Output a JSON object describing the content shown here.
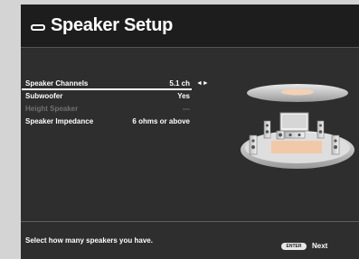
{
  "header": {
    "title": "Speaker Setup",
    "title_icon": "speaker-setup-icon"
  },
  "menu": {
    "items": [
      {
        "label": "Speaker Channels",
        "value": "5.1 ch",
        "selected": true,
        "enabled": true
      },
      {
        "label": "Subwoofer",
        "value": "Yes",
        "selected": false,
        "enabled": true
      },
      {
        "label": "Height Speaker",
        "value": "---",
        "selected": false,
        "enabled": false
      },
      {
        "label": "Speaker Impedance",
        "value": "6 ohms or above",
        "selected": false,
        "enabled": true
      }
    ],
    "adjust_arrows": "◄►"
  },
  "footer": {
    "hint": "Select how many speakers you have.",
    "enter_key": "ENTER",
    "next_label": "Next"
  },
  "colors": {
    "panel_bg": "#2e2e2e",
    "header_bg": "#1d1d1d",
    "page_bg": "#d4d4d4",
    "text": "#ffffff",
    "disabled_text": "#707070"
  }
}
